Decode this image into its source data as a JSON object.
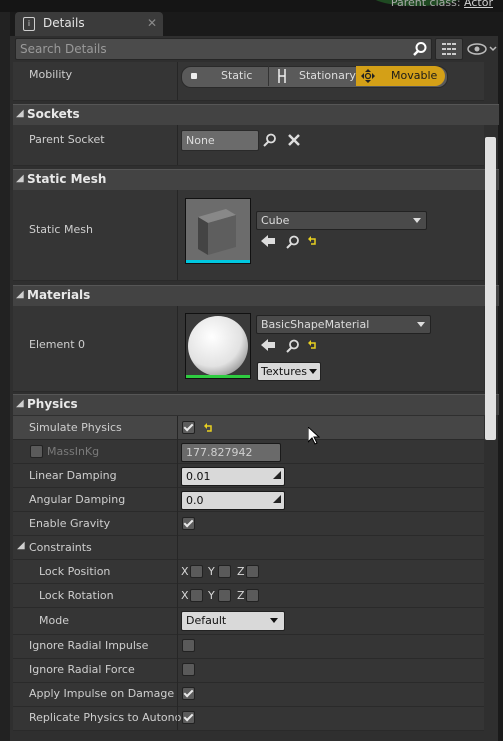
{
  "top": {
    "parent_label": "Parent class: ",
    "parent_value": "Actor"
  },
  "tab": {
    "title": "Details"
  },
  "search": {
    "placeholder": "Search Details"
  },
  "mobility": {
    "label": "Mobility",
    "options": [
      "Static",
      "Stationary",
      "Movable"
    ],
    "selected": "Movable"
  },
  "sockets": {
    "title": "Sockets",
    "parent_socket_label": "Parent Socket",
    "parent_socket_value": "None"
  },
  "static_mesh": {
    "title": "Static Mesh",
    "label": "Static Mesh",
    "value": "Cube"
  },
  "materials": {
    "title": "Materials",
    "element_label": "Element 0",
    "value": "BasicShapeMaterial",
    "textures_label": "Textures"
  },
  "physics": {
    "title": "Physics",
    "simulate_physics": {
      "label": "Simulate Physics",
      "checked": true
    },
    "mass": {
      "label": "MassInKg",
      "value": "177.827942"
    },
    "linear_damping": {
      "label": "Linear Damping",
      "value": "0.01"
    },
    "angular_damping": {
      "label": "Angular Damping",
      "value": "0.0"
    },
    "enable_gravity": {
      "label": "Enable Gravity",
      "checked": true
    },
    "constraints": {
      "title": "Constraints",
      "lock_position": {
        "label": "Lock Position",
        "axes": [
          "X",
          "Y",
          "Z"
        ]
      },
      "lock_rotation": {
        "label": "Lock Rotation",
        "axes": [
          "X",
          "Y",
          "Z"
        ]
      },
      "mode": {
        "label": "Mode",
        "value": "Default"
      }
    },
    "ignore_radial_impulse": {
      "label": "Ignore Radial Impulse",
      "checked": false
    },
    "ignore_radial_force": {
      "label": "Ignore Radial Force",
      "checked": false
    },
    "apply_impulse": {
      "label": "Apply Impulse on Damage",
      "checked": true
    },
    "replicate_physics": {
      "label": "Replicate Physics to Autonom",
      "checked": true
    }
  },
  "colors": {
    "accent": "#d4a017",
    "mesh_bar": "#00c8e0",
    "material_bar": "#2ecc40"
  }
}
